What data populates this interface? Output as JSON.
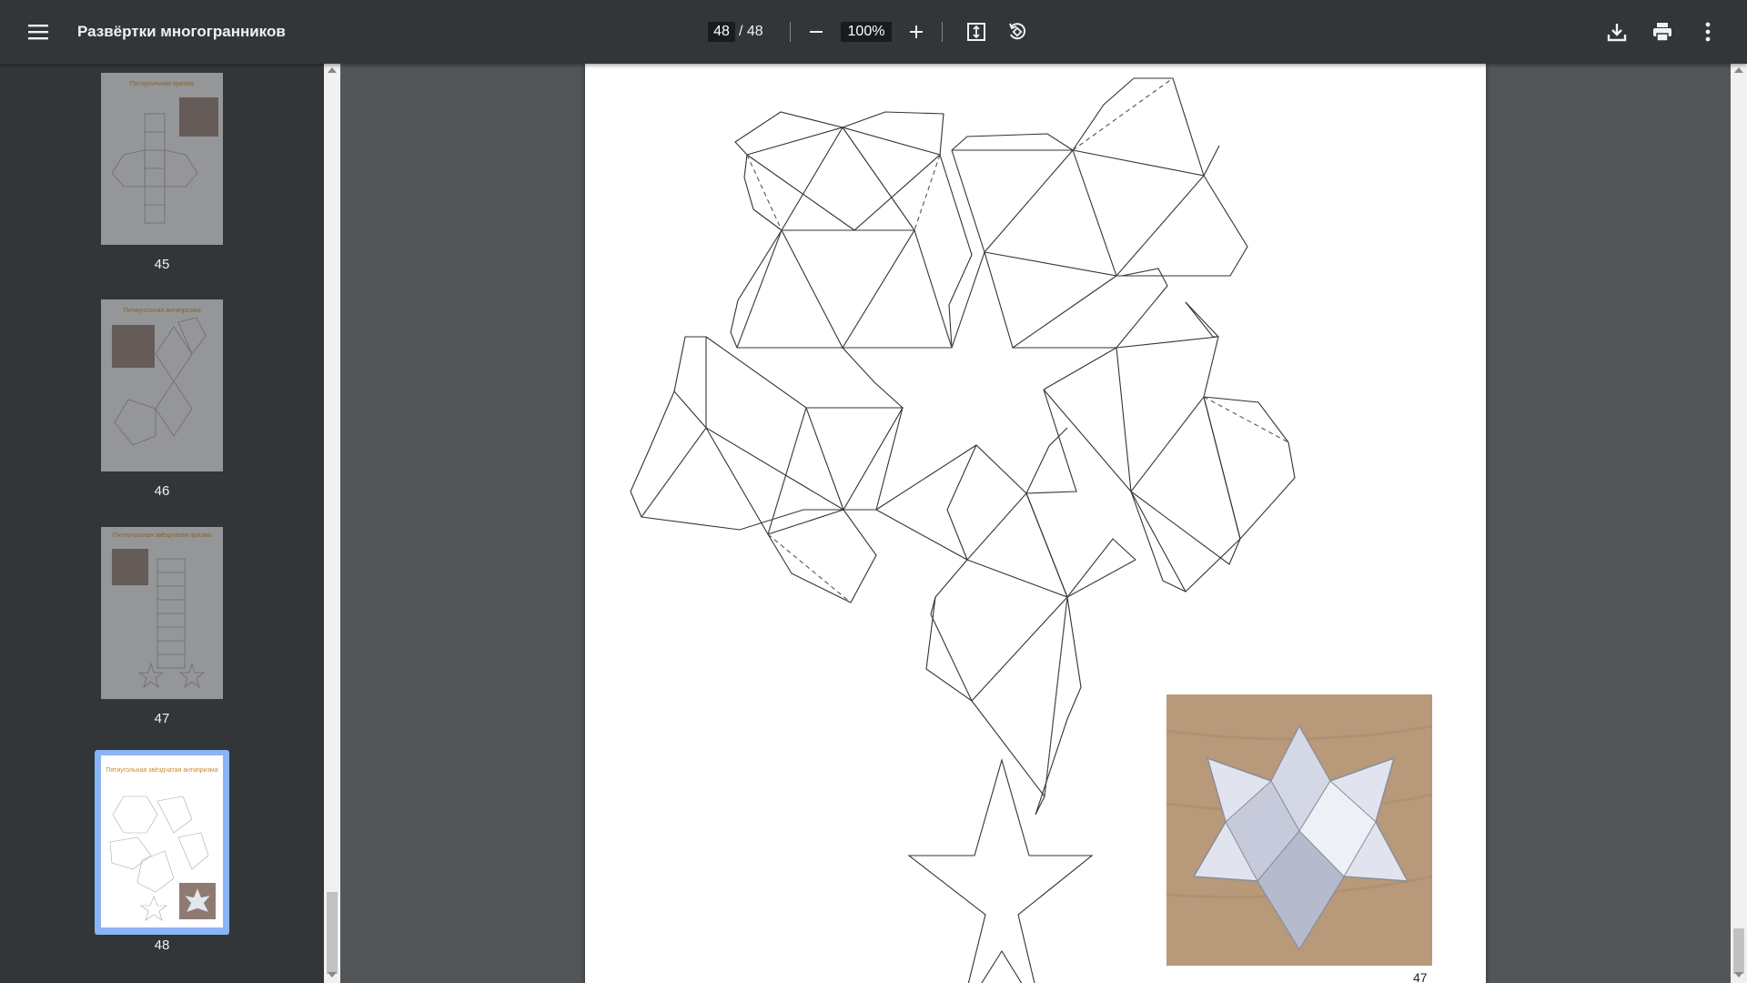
{
  "toolbar": {
    "title": "Развёртки многогранников",
    "current_page": "48",
    "page_separator": "/ 48",
    "zoom": "100%"
  },
  "sidebar": {
    "thumbnails": [
      {
        "page": "45",
        "title": "Пятиугольная призма"
      },
      {
        "page": "46",
        "title": "Пятиугольная антипризма"
      },
      {
        "page": "47",
        "title": "Пятиугольная звёздчатая призма"
      },
      {
        "page": "48",
        "title": "Пятиугольная звёздчатая антипризма"
      }
    ]
  },
  "document": {
    "footer_page_number": "47"
  },
  "colors": {
    "toolbar": "#323639",
    "viewer_bg": "#525659",
    "selected_thumb": "#8ab4f8"
  }
}
